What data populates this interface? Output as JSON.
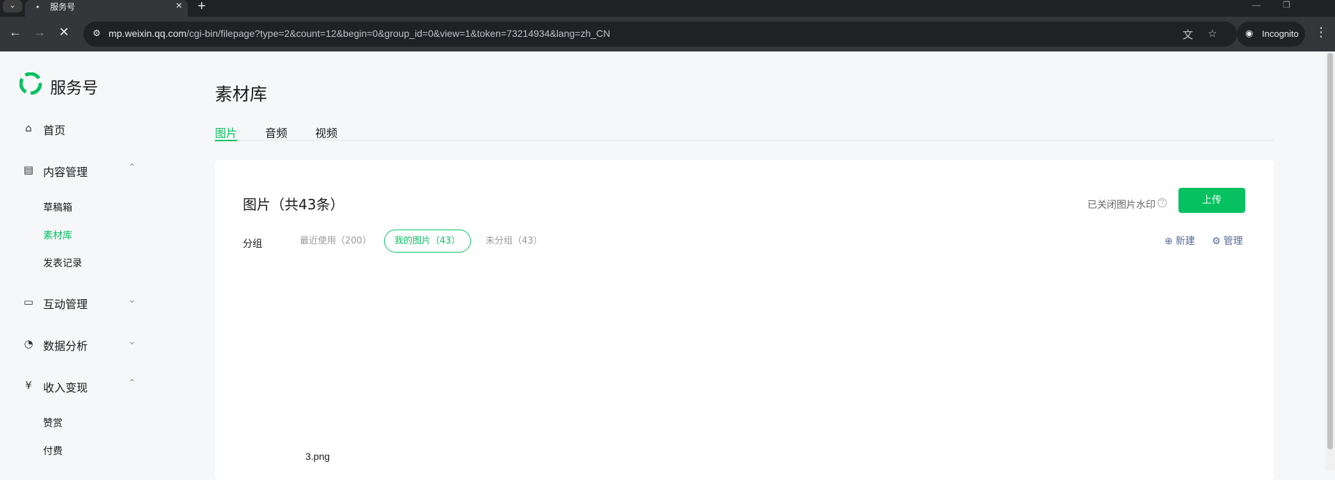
{
  "browser": {
    "tab_title": "服务号",
    "url_host": "mp.weixin.qq.com",
    "url_path": "/cgi-bin/filepage?type=2&count=12&begin=0&group_id=0&view=1&token=73214934&lang=zh_CN",
    "incognito_label": "Incognito"
  },
  "sidebar": {
    "brand": "服务号",
    "home": "首页",
    "content_mgmt": "内容管理",
    "content_sub": [
      "草稿箱",
      "素材库",
      "发表记录"
    ],
    "interaction": "互动管理",
    "analytics": "数据分析",
    "monetize": "收入变现",
    "monetize_sub": [
      "赞赏",
      "付费"
    ]
  },
  "main": {
    "title": "素材库",
    "tabs": [
      "图片",
      "音频",
      "视频"
    ],
    "card_title": "图片（共43条）",
    "watermark": "已关闭图片水印",
    "upload": "上传",
    "group_label": "分组",
    "groups": [
      "最近使用（200）",
      "我的图片（43）",
      "未分组（43）"
    ],
    "new_label": "新建",
    "manage_label": "管理",
    "file_name": "3.png"
  },
  "colors": {
    "accent": "#07c160",
    "link": "#576b95"
  }
}
